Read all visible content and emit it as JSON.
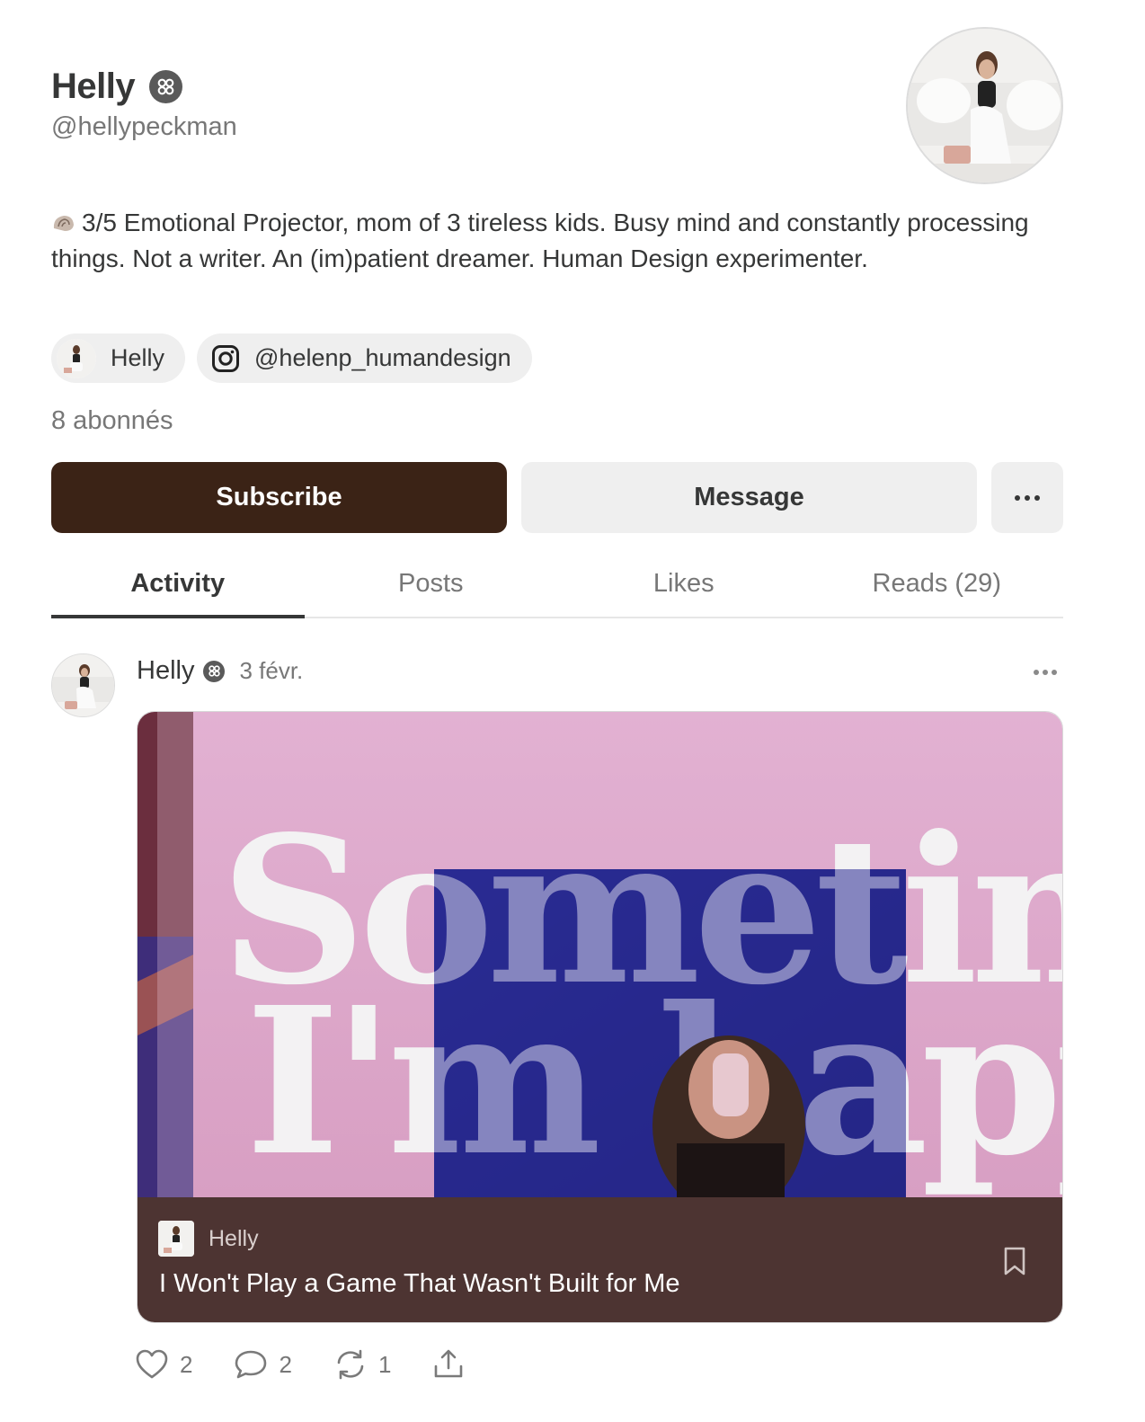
{
  "profile": {
    "name": "Helly",
    "handle": "@hellypeckman",
    "bio": "3/5 Emotional Projector, mom of 3 tireless kids. Busy mind and constantly processing things. Not a writer. An (im)patient dreamer. Human Design experimenter.",
    "links": [
      {
        "label": "Helly",
        "icon": "avatar"
      },
      {
        "label": "@helenp_humandesign",
        "icon": "instagram-icon"
      }
    ],
    "subscribers": "8 abonnés"
  },
  "buttons": {
    "subscribe": "Subscribe",
    "message": "Message",
    "more": "more-icon"
  },
  "tabs": [
    "Activity",
    "Posts",
    "Likes",
    "Reads (29)"
  ],
  "active_tab": "Activity",
  "post": {
    "author": "Helly",
    "date": "3 févr.",
    "card": {
      "publication": "Helly",
      "title": "I Won't Play a Game That Wasn't Built for Me"
    },
    "actions": {
      "likes": "2",
      "comments": "2",
      "restacks": "1"
    }
  },
  "colors": {
    "subscribe_bg": "#3b2316",
    "card_footer_bg": "#4d3432",
    "text": "#363737",
    "muted": "#777777"
  }
}
